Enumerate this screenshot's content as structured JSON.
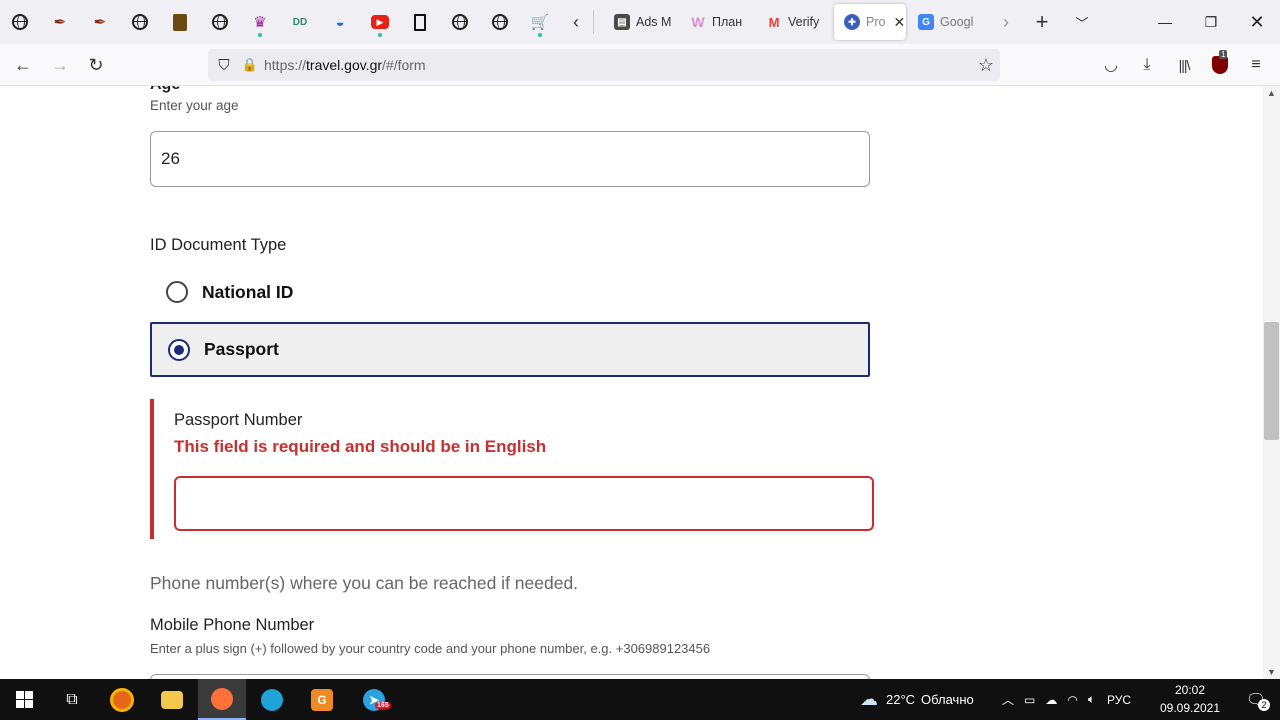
{
  "browser": {
    "pinned_icons": [
      "globe-icon",
      "quill-icon",
      "quill-icon",
      "globe-icon",
      "book-icon",
      "globe-icon",
      "crown-icon",
      "dd-icon",
      "wave-icon",
      "youtube-icon",
      "bracket-icon",
      "globe-icon",
      "globe-icon",
      "cart-icon"
    ],
    "tabs": [
      {
        "label": "Ads M",
        "favicon_color": "#4a4a4a",
        "favicon_text": "▤"
      },
      {
        "label": "План",
        "favicon_color": "#e6a3d8",
        "favicon_text": "W"
      },
      {
        "label": "Verify",
        "favicon_color": "#ea4335",
        "favicon_text": "M"
      },
      {
        "label": "Pro",
        "favicon_color": "#3b5fc0",
        "favicon_text": "✚",
        "active": true
      },
      {
        "label": "Googl",
        "favicon_color": "#4285f4",
        "favicon_text": "G"
      }
    ],
    "url": {
      "prefix": "https://",
      "host": "travel.gov.gr",
      "path": "/#/form"
    }
  },
  "form": {
    "age": {
      "label": "Age",
      "hint": "Enter your age",
      "value": "26"
    },
    "id_document": {
      "label": "ID Document Type",
      "options": [
        {
          "label": "National ID",
          "checked": false
        },
        {
          "label": "Passport",
          "checked": true
        }
      ]
    },
    "passport_number": {
      "label": "Passport Number",
      "error": "This field is required and should be in English",
      "value": ""
    },
    "phone_section": {
      "text": "Phone number(s) where you can be reached if needed."
    },
    "mobile_phone": {
      "label": "Mobile Phone Number",
      "hint": "Enter a plus sign (+) followed by your country code and your phone number, e.g. +306989123456"
    }
  },
  "taskbar": {
    "weather": {
      "temp": "22°C",
      "desc": "Облачно"
    },
    "language": "РУС",
    "time": "20:02",
    "date": "09.09.2021",
    "notifications": "2",
    "telegram_badge": "165"
  },
  "colors": {
    "accent": "#1d2a7a",
    "error": "#c7302f"
  }
}
